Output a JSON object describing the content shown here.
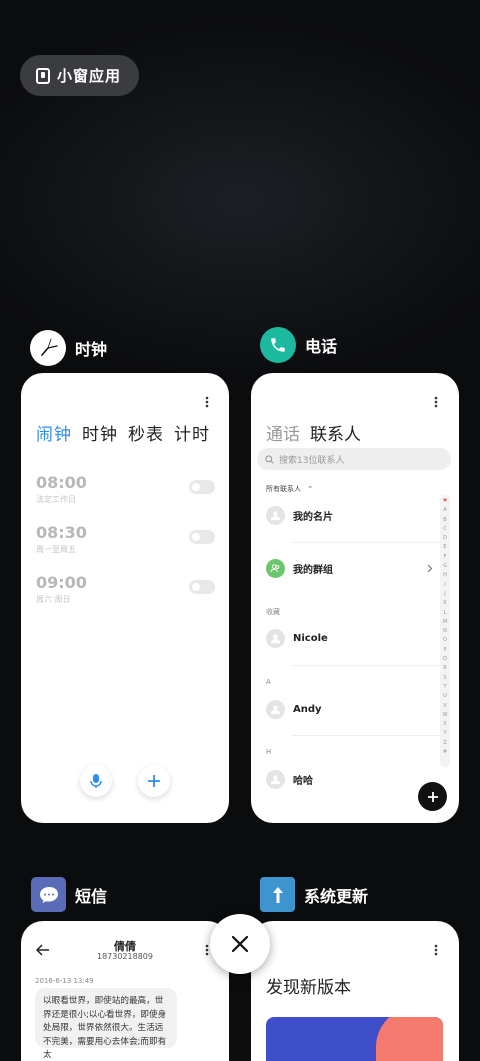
{
  "small_window": {
    "label": "小窗应用"
  },
  "apps": {
    "clock": {
      "name": "时钟",
      "tabs": [
        "闹钟",
        "时钟",
        "秒表",
        "计时"
      ],
      "alarms": [
        {
          "time": "08:00",
          "days": "法定工作日"
        },
        {
          "time": "08:30",
          "days": "周一至周五"
        },
        {
          "time": "09:00",
          "days": "周六 周日"
        }
      ]
    },
    "phone": {
      "name": "电话",
      "tabs": [
        "通话",
        "联系人"
      ],
      "search_placeholder": "搜索13位联系人",
      "all_contacts": "所有联系人",
      "my_card": "我的名片",
      "my_groups": "我的群组",
      "favorites": "收藏",
      "section_a": "A",
      "section_h": "H",
      "contacts": [
        "Nicole",
        "Andy",
        "哈哈"
      ],
      "index": [
        "♥",
        "A",
        "B",
        "C",
        "D",
        "E",
        "F",
        "G",
        "H",
        "I",
        "J",
        "K",
        "L",
        "M",
        "N",
        "O",
        "P",
        "Q",
        "R",
        "S",
        "T",
        "U",
        "V",
        "W",
        "X",
        "Y",
        "Z",
        "#"
      ]
    },
    "sms": {
      "name": "短信",
      "contact": "倩倩",
      "number": "18730218809",
      "date": "2016-6-13 13:49",
      "message": "以眼看世界，即使站的最高，世界还是很小;以心看世界，即使身处局限，世界依然很大。生活远不完美，需要用心去体会;而即有太"
    },
    "update": {
      "name": "系统更新",
      "title": "发现新版本"
    }
  },
  "colors": {
    "accent": "#2f8cf0",
    "phone_icon": "#1cb99e",
    "sms_icon": "#5a6cb8",
    "update_icon": "#3d94cf",
    "group_icon": "#6cc56a"
  }
}
